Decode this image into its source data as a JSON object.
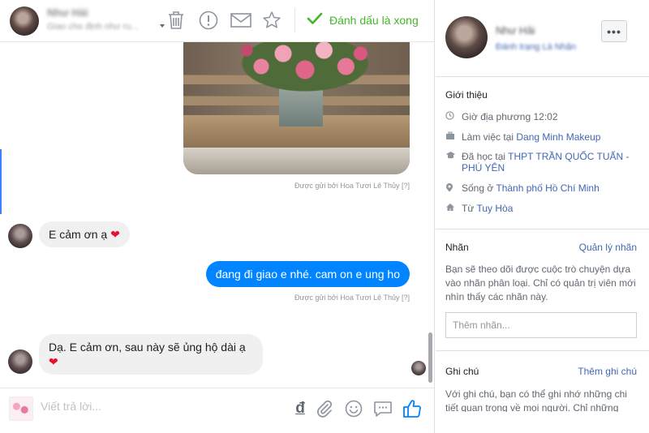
{
  "header": {
    "contact_name": "Như Hải",
    "contact_subtitle": "Giao cho định như ru...",
    "done_label": "Đánh dấu là xong",
    "icons": [
      "trash-icon",
      "alert-icon",
      "envelope-icon",
      "star-icon",
      "checkmark-icon"
    ]
  },
  "thread": {
    "sent_by_1": "Được gửi bởi Hoa Tươi Lê Thủy",
    "sent_by_2": "Được gửi bởi Hoa Tươi Lê Thủy",
    "help_mark": "[?]",
    "msg_in_1": "E cảm ơn ạ",
    "msg_out_1": "đang đi giao e nhé. cam on e ung ho",
    "msg_in_2": "Dạ. E cảm ơn, sau này sẽ ủng hộ dài ạ",
    "heart": "❤"
  },
  "composer": {
    "placeholder": "Viết trả lời...",
    "currency_symbol": "đ",
    "icons": [
      "attach-icon",
      "emoji-icon",
      "saved-reply-icon",
      "like-icon"
    ]
  },
  "info": {
    "name": "Như Hải",
    "subtitle": "Đánh trạng Là Nhận",
    "more": "•••",
    "about_title": "Giới thiệu",
    "local_time": "Giờ địa phương 12:02",
    "work_prefix": "Làm việc tại ",
    "work_place": "Dang Minh Makeup",
    "study_prefix": "Đã học tại ",
    "study_place": "THPT TRẦN QUỐC TUẤN - PHÚ YÊN",
    "live_prefix": "Sống ở ",
    "live_place": "Thành phố Hồ Chí Minh",
    "from_prefix": "Từ ",
    "from_place": "Tuy Hòa",
    "labels_title": "Nhãn",
    "labels_manage": "Quản lý nhãn",
    "labels_desc": "Bạn sẽ theo dõi được cuộc trò chuyện dựa vào nhãn phân loại. Chỉ có quản trị viên mới nhìn thấy các nhãn này.",
    "labels_placeholder": "Thêm nhãn...",
    "notes_title": "Ghi chú",
    "notes_add": "Thêm ghi chú",
    "notes_desc": "Với ghi chú, bạn có thể ghi nhớ những chi tiết quan trọng về mọi người. Chỉ những"
  },
  "colors": {
    "accent_green": "#42b72a",
    "messenger_blue": "#0084ff",
    "link_blue": "#4267b2",
    "like_blue": "#0084ff"
  }
}
